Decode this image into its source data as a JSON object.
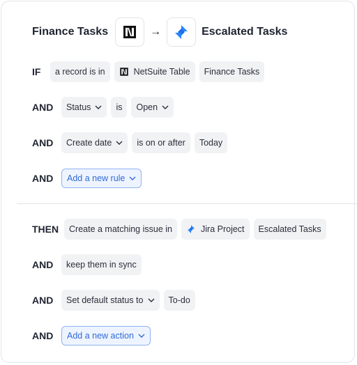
{
  "header": {
    "source_title": "Finance Tasks",
    "source_icon": "netsuite-logo-icon",
    "arrow": "→",
    "target_icon": "jira-logo-icon",
    "target_title": "Escalated Tasks"
  },
  "conditions": [
    {
      "keyword": "IF",
      "parts": [
        "a record is in",
        "NetSuite Table",
        "Finance Tasks"
      ]
    },
    {
      "keyword": "AND",
      "parts": [
        "Status",
        "is",
        "Open"
      ]
    },
    {
      "keyword": "AND",
      "parts": [
        "Create date",
        "is on or after",
        "Today"
      ]
    },
    {
      "keyword": "AND",
      "parts": [
        "Add a new rule"
      ]
    }
  ],
  "actions": [
    {
      "keyword": "THEN",
      "parts": [
        "Create a matching issue in",
        "Jira Project",
        "Escalated Tasks"
      ]
    },
    {
      "keyword": "AND",
      "parts": [
        "keep them in sync"
      ]
    },
    {
      "keyword": "AND",
      "parts": [
        "Set default status to",
        "To-do"
      ]
    },
    {
      "keyword": "AND",
      "parts": [
        "Add a new action"
      ]
    }
  ],
  "colors": {
    "accent": "#2f6ad7",
    "chip_bg": "#f1f2f4",
    "jira_blue": "#2684ff"
  }
}
